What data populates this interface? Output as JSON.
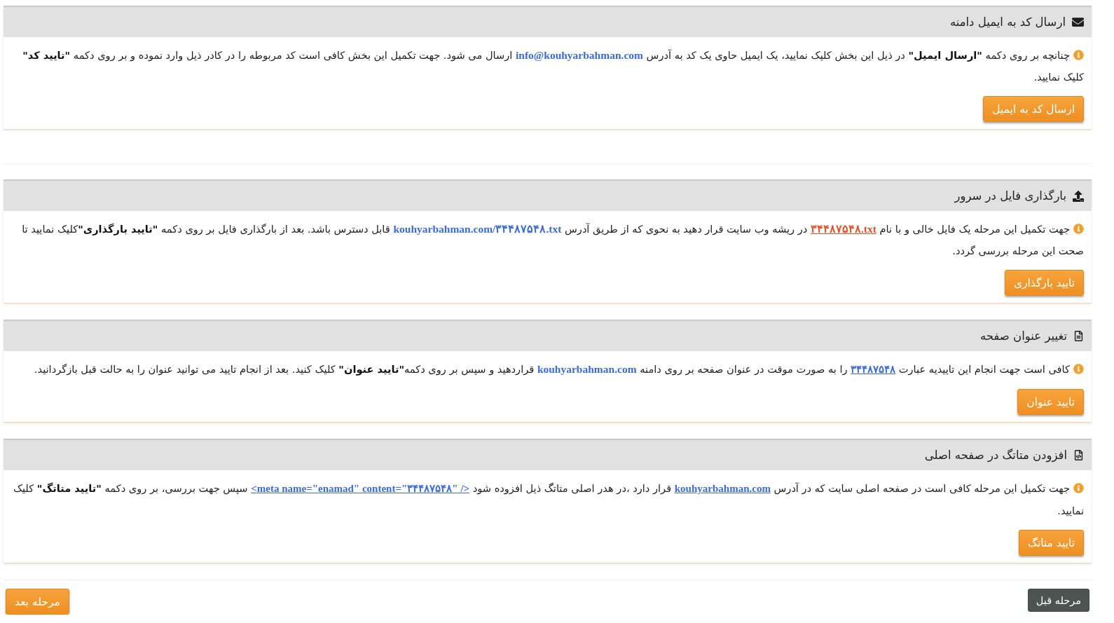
{
  "panels": [
    {
      "kind": "email",
      "title": "ارسال کد به ایمیل دامنه",
      "text": [
        {
          "kind": "text",
          "text": "چنانچه بر روی دکمه **\"ارسال ایمیل\"** در ذیل این بخش کلیک نمایید، یک ایمیل حاوی یک کد به آدرس "
        },
        {
          "kind": "address",
          "text": "info@kouhyarbahman.com"
        },
        {
          "kind": "text",
          "text": " ارسال می شود. جهت تکمیل این بخش کافی است کد مربوطه را در کادر ذیل وارد نموده و بر روی دکمه **\"تایید کد\"** کلیک نمایید."
        }
      ],
      "button": "ارسال کد به ایمیل"
    },
    {
      "kind": "upload",
      "title": "بارگذاری فایل در سرور",
      "text": [
        {
          "kind": "text",
          "text": "جهت تکمیل این مرحله یک فایل خالی و با نام "
        },
        {
          "kind": "file",
          "text": "۳۴۴۸۷۵۴۸.txt"
        },
        {
          "kind": "text",
          "text": " در ریشه وب سایت قرار دهید به نحوی که از طریق آدرس "
        },
        {
          "kind": "address",
          "text": "kouhyarbahman.com/۳۴۴۸۷۵۴۸.txt"
        },
        {
          "kind": "text",
          "text": "  قابل دسترس باشد. بعد از بارگذاری فایل بر روی دکمه **\"تایید بارگذاری\"**کلیک نمایید تا صحت این مرحله بررسی گردد."
        }
      ],
      "button": "تایید بارگذاری"
    },
    {
      "kind": "title",
      "title": "تغییر عنوان صفحه",
      "text": [
        {
          "kind": "text",
          "text": "کافی است جهت انجام این تاییدیه عبارت "
        },
        {
          "kind": "link",
          "text": "۳۴۴۸۷۵۴۸"
        },
        {
          "kind": "text",
          "text": " را به صورت موقت در عنوان صفحه بر روی دامنه "
        },
        {
          "kind": "address",
          "text": "kouhyarbahman.com"
        },
        {
          "kind": "text",
          "text": " قراردهید و سپس بر روی دکمه**\"تایید عنوان\"** کلیک کنید. بعد از انجام تایید می توانید عنوان را به حالت قبل بازگردانید."
        }
      ],
      "button": "تایید عنوان"
    },
    {
      "kind": "meta",
      "title": "افزودن متاتگ در صفحه اصلی",
      "text": [
        {
          "kind": "text",
          "text": "جهت تکمیل این مرحله کافی است در صفحه اصلی سایت که در آدرس "
        },
        {
          "kind": "link",
          "text": "kouhyarbahman.com"
        },
        {
          "kind": "text",
          "text": " قرار دارد ،در هدر اصلی متاتگ ذیل افزوده شود "
        },
        {
          "kind": "link",
          "text": "<meta name=\"enamad\" content=\"۳۴۴۸۷۵۴۸\" />"
        },
        {
          "kind": "text",
          "text": " سپس جهت بررسی، بر روی دکمه **\"تایید متاتگ\"** کلیک نمایید."
        }
      ],
      "button": "تایید متاتگ"
    }
  ],
  "footer": {
    "buttons": [
      {
        "kind": "secondary",
        "label": "مرحله قبل"
      },
      {
        "kind": "primary",
        "label": "مرحله بعد"
      }
    ]
  }
}
